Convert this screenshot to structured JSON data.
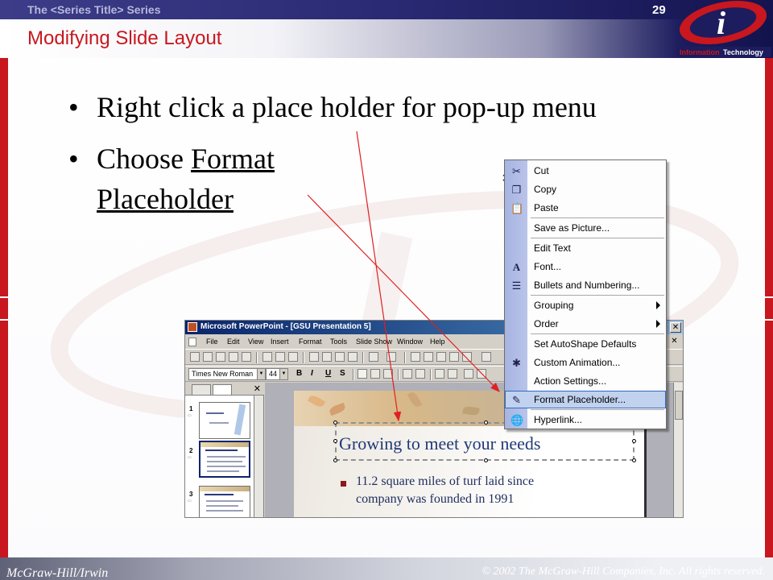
{
  "header": {
    "series_title": "The <Series Title> Series",
    "slide_number": "29",
    "section_title": "Modifying Slide Layout",
    "logo_text_a": "Information",
    "logo_text_b": "Technology",
    "logo_letter": "i"
  },
  "bullets": {
    "b1": "Right click a place holder for pop-up menu",
    "b2_prefix": "Choose ",
    "b2_link1": "Format",
    "b2_link2": "Placeholder"
  },
  "footer": {
    "left": "McGraw-Hill/Irwin",
    "right": "© 2002 The McGraw-Hill Companies, Inc. All rights reserved."
  },
  "pp_window": {
    "title": "Microsoft PowerPoint - [GSU Presentation 5]",
    "menus": [
      "File",
      "Edit",
      "View",
      "Insert",
      "Format",
      "Tools",
      "Slide Show",
      "Window",
      "Help"
    ],
    "font": "Times New Roman",
    "size": "44",
    "fmt_buttons": [
      "B",
      "I",
      "U",
      "S"
    ],
    "thumb_numbers": [
      "1",
      "2",
      "3"
    ],
    "slide_title": "Growing to meet your needs",
    "slide_line1": "11.2 square miles of turf laid since",
    "slide_line2": "company was founded in 1991"
  },
  "context_menu": {
    "items": [
      {
        "label": "Cut",
        "icon": "scissors-icon"
      },
      {
        "label": "Copy",
        "icon": "copy-icon"
      },
      {
        "label": "Paste",
        "icon": "paste-icon"
      },
      {
        "label": "Save as Picture...",
        "icon": ""
      },
      {
        "label": "Edit Text",
        "icon": ""
      },
      {
        "label": "Font...",
        "icon": "font-icon"
      },
      {
        "label": "Bullets and Numbering...",
        "icon": "bullets-icon"
      },
      {
        "label": "Grouping",
        "icon": ""
      },
      {
        "label": "Order",
        "icon": ""
      },
      {
        "label": "Set AutoShape Defaults",
        "icon": ""
      },
      {
        "label": "Custom Animation...",
        "icon": "animation-icon"
      },
      {
        "label": "Action Settings...",
        "icon": ""
      },
      {
        "label": "Format Placeholder...",
        "icon": "format-placeholder-icon"
      },
      {
        "label": "Hyperlink...",
        "icon": "hyperlink-icon"
      }
    ]
  },
  "colors": {
    "accent_red": "#c8171e",
    "header_navy": "#1c1c5e",
    "menu_highlight": "#c1d2ee",
    "arrow": "#e02020"
  }
}
